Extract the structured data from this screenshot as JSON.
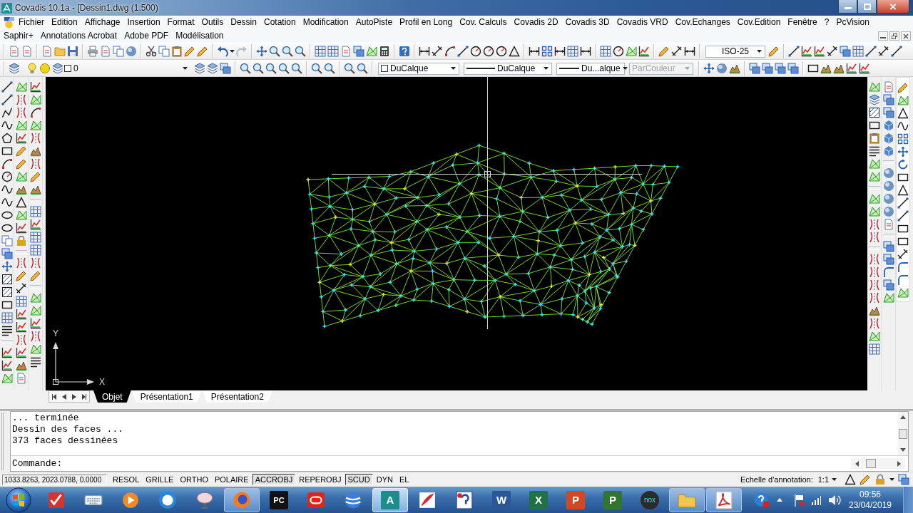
{
  "window": {
    "title": "Covadis 10.1a - [Dessin1.dwg (1:500)"
  },
  "menu_bar": {
    "rows": [
      {
        "items": [
          "Fichier",
          "Edition",
          "Affichage",
          "Insertion",
          "Format",
          "Outils",
          "Dessin",
          "Cotation",
          "Modification",
          "AutoPiste",
          "Profil en Long",
          "Cov. Calculs",
          "Covadis 2D",
          "Covadis 3D",
          "Covadis VRD",
          "Cov.Echanges",
          "Cov.Edition",
          "Fenêtre",
          "?",
          "PcVision"
        ]
      },
      {
        "items": [
          "Saphir+",
          "Annotations Acrobat",
          "Adobe PDF",
          "Modélisation"
        ]
      }
    ]
  },
  "toolbars": {
    "dimension_style": "ISO-25",
    "layer": "0",
    "property_dropdowns": [
      {
        "kind": "color",
        "value": "DuCalque",
        "disabled": false
      },
      {
        "kind": "linetype",
        "value": "DuCalque",
        "disabled": false
      },
      {
        "kind": "lineweight",
        "value": "Du...alque",
        "disabled": false
      },
      {
        "kind": "plot_style",
        "value": "ParCouleur",
        "disabled": true
      }
    ]
  },
  "drawing": {
    "ucs_y_label": "Y",
    "ucs_x_label": "X"
  },
  "layout_tabs": [
    {
      "label": "Objet",
      "selected": true
    },
    {
      "label": "Présentation1",
      "selected": false
    },
    {
      "label": "Présentation2",
      "selected": false
    }
  ],
  "command_window": {
    "history": [
      "... terminée",
      "Dessin des faces ...",
      "373 faces dessinées"
    ],
    "prompt": "Commande:"
  },
  "status_bar": {
    "coordinates": "1033.8263, 2023.0788, 0.0000",
    "toggles": [
      {
        "label": "RESOL",
        "on": false
      },
      {
        "label": "GRILLE",
        "on": false
      },
      {
        "label": "ORTHO",
        "on": false
      },
      {
        "label": "POLAIRE",
        "on": false
      },
      {
        "label": "ACCROBJ",
        "on": true
      },
      {
        "label": "REPEROBJ",
        "on": false
      },
      {
        "label": "SCUD",
        "on": true
      },
      {
        "label": "DYN",
        "on": false
      },
      {
        "label": "EL",
        "on": false
      }
    ],
    "annotation_scale_label": "Echelle d'annotation:",
    "annotation_scale": "1:1"
  },
  "taskbar": {
    "apps": [
      {
        "running": false,
        "selected": false
      },
      {
        "running": false,
        "selected": false
      },
      {
        "running": false,
        "selected": false
      },
      {
        "running": false,
        "selected": false
      },
      {
        "running": false,
        "selected": false
      },
      {
        "running": true,
        "selected": false
      },
      {
        "glyph": "PC",
        "running": false,
        "selected": false
      },
      {
        "running": false,
        "selected": false
      },
      {
        "running": false,
        "selected": false
      },
      {
        "glyph": "A",
        "running": true,
        "selected": true
      },
      {
        "running": false,
        "selected": false
      },
      {
        "running": false,
        "selected": false
      },
      {
        "glyph": "W",
        "running": false,
        "selected": false
      },
      {
        "glyph": "X",
        "running": false,
        "selected": false
      },
      {
        "glyph": "P",
        "running": false,
        "selected": false
      },
      {
        "glyph": "P",
        "running": false,
        "selected": false
      },
      {
        "glyph": "nox",
        "running": false,
        "selected": false
      },
      {
        "running": true,
        "selected": false
      },
      {
        "running": true,
        "selected": false
      }
    ],
    "time": "09:56",
    "date": "23/04/2019"
  }
}
